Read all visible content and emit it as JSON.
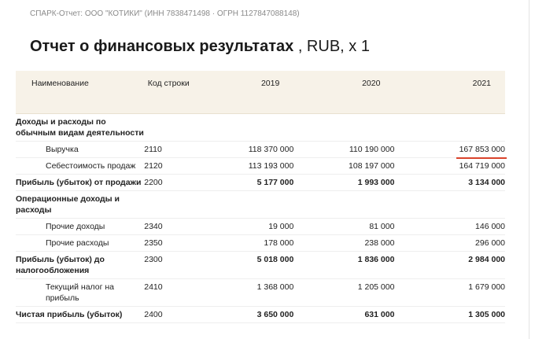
{
  "header": {
    "breadcrumb": "СПАРК-Отчет: ООО \"КОТИКИ\" (ИНН 7838471498 · ОГРН 1127847088148)"
  },
  "report": {
    "title_bold": "Отчет о финансовых результатах",
    "title_suffix": " , RUB, x 1",
    "columns": {
      "name": "Наименование",
      "code": "Код строки",
      "y1": "2019",
      "y2": "2020",
      "y3": "2021"
    },
    "rows": [
      {
        "name": "Доходы и расходы по обычным видам деятельности",
        "code": "",
        "y1": "",
        "y2": "",
        "y3": ""
      },
      {
        "name": "Выручка",
        "code": "2110",
        "y1": "118 370 000",
        "y2": "110 190 000",
        "y3": "167 853 000"
      },
      {
        "name": "Себестоимость продаж",
        "code": "2120",
        "y1": "113 193 000",
        "y2": "108 197 000",
        "y3": "164 719 000"
      },
      {
        "name": "Прибыль (убыток) от продажи",
        "code": "2200",
        "y1": "5 177 000",
        "y2": "1 993 000",
        "y3": "3 134 000"
      },
      {
        "name": "Операционные доходы и расходы",
        "code": "",
        "y1": "",
        "y2": "",
        "y3": ""
      },
      {
        "name": "Прочие доходы",
        "code": "2340",
        "y1": "19 000",
        "y2": "81 000",
        "y3": "146 000"
      },
      {
        "name": "Прочие расходы",
        "code": "2350",
        "y1": "178 000",
        "y2": "238 000",
        "y3": "296 000"
      },
      {
        "name": "Прибыль (убыток) до налогообложения",
        "code": "2300",
        "y1": "5 018 000",
        "y2": "1 836 000",
        "y3": "2 984 000"
      },
      {
        "name": "Текущий налог на прибыль",
        "code": "2410",
        "y1": "1 368 000",
        "y2": "1 205 000",
        "y3": "1 679 000"
      },
      {
        "name": "Чистая прибыль (убыток)",
        "code": "2400",
        "y1": "3 650 000",
        "y2": "631 000",
        "y3": "1 305 000"
      }
    ]
  },
  "colors": {
    "header_bg": "#f7f2e8",
    "highlight_underline": "#d9432b"
  }
}
